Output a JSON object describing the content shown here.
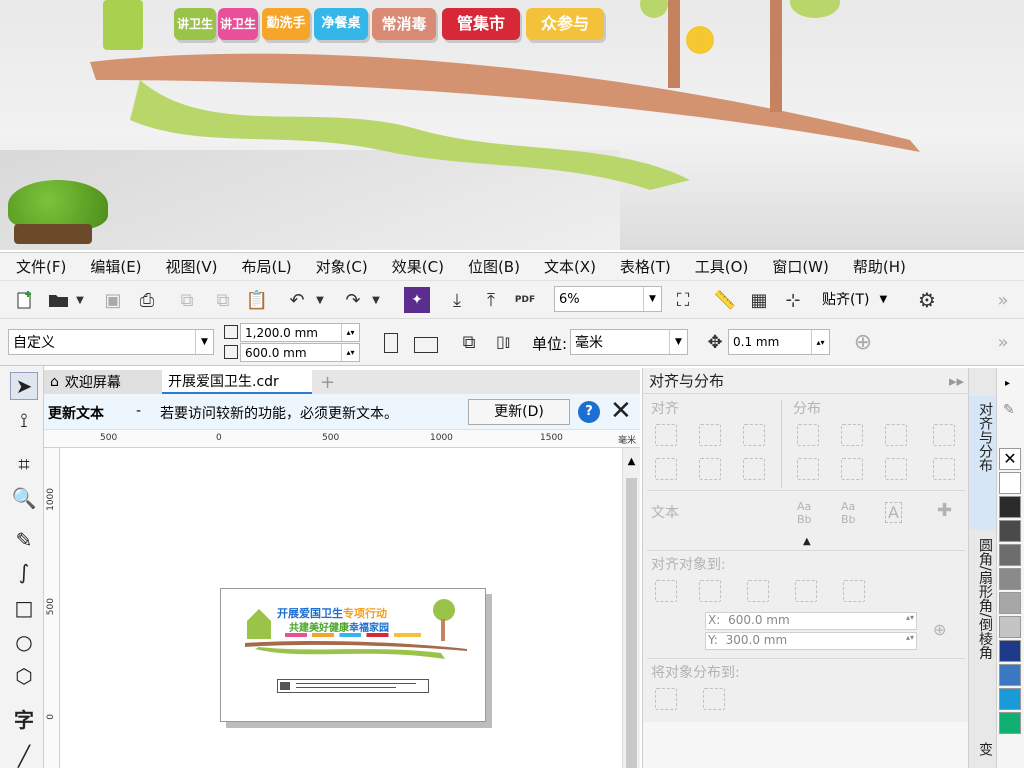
{
  "menu": [
    "文件(F)",
    "编辑(E)",
    "视图(V)",
    "布局(L)",
    "对象(C)",
    "效果(C)",
    "位图(B)",
    "文本(X)",
    "表格(T)",
    "工具(O)",
    "窗口(W)",
    "帮助(H)"
  ],
  "photo_signs": [
    "讲卫生",
    "讲卫生",
    "勤洗手",
    "净餐桌",
    "常消毒",
    "管集市",
    "众参与"
  ],
  "toolbar": {
    "zoom": "6%",
    "snap_label": "贴齐(T)"
  },
  "propbar": {
    "preset": "自定义",
    "width": "1,200.0 mm",
    "height": "600.0 mm",
    "unit_label": "单位:",
    "unit": "毫米",
    "nudge": "0.1 mm"
  },
  "tabs": {
    "welcome": "欢迎屏幕",
    "document": "开展爱国卫生.cdr"
  },
  "infobar": {
    "title": "更新文本",
    "message": "若要访问较新的功能，必须更新文本。",
    "update_button": "更新(D)"
  },
  "ruler_h": [
    "500",
    "0",
    "500",
    "1000",
    "1500",
    "毫米"
  ],
  "ruler_v": [
    "1000",
    "500",
    "0"
  ],
  "artwork": {
    "line1a": "开展爱国卫生",
    "line1b": "专项行动",
    "line2a": "共建美好健康",
    "line2b": "幸福家园"
  },
  "docker": {
    "title": "对齐与分布",
    "align_label": "对齐",
    "distribute_label": "分布",
    "text_label": "文本",
    "align_to_label": "对齐对象到:",
    "x_value": "600.0 mm",
    "y_value": "300.0 mm",
    "distribute_to_label": "将对象分布到:"
  },
  "side_tabs": [
    "对齐与分布",
    "圆角/扇形角/倒棱角",
    "变"
  ],
  "palette_colors": [
    "#ffffff",
    "#2b2b2b",
    "#4a4a4a",
    "#6d6d6d",
    "#8a8a8a",
    "#a7a7a7",
    "#c4c4c4",
    "#203a8a",
    "#3b78c2",
    "#1a9ad6",
    "#10b070"
  ]
}
